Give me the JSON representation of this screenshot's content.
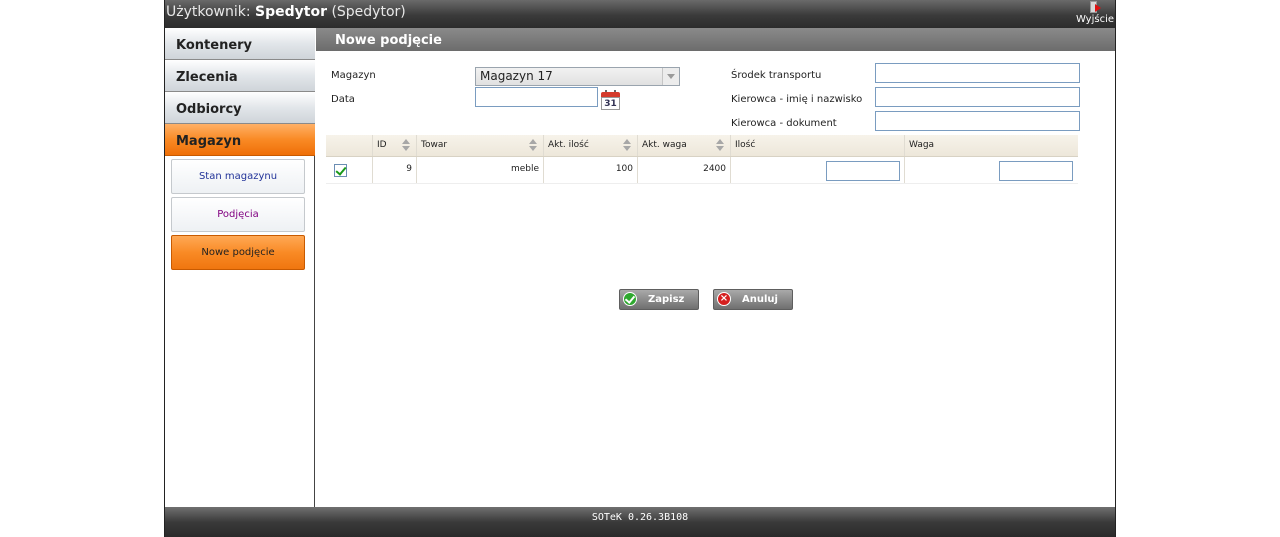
{
  "header": {
    "user_prefix": "Użytkownik: ",
    "user_name": "Spedytor",
    "user_role": " (Spedytor)",
    "logout_label": "Wyjście"
  },
  "sidebar": {
    "items": [
      {
        "label": "Kontenery"
      },
      {
        "label": "Zlecenia"
      },
      {
        "label": "Odbiorcy"
      },
      {
        "label": "Magazyn",
        "active": true
      }
    ],
    "subitems": [
      {
        "label": "Stan magazynu"
      },
      {
        "label": "Podjęcia"
      },
      {
        "label": "Nowe podjęcie",
        "active": true
      }
    ]
  },
  "main": {
    "title": "Nowe podjęcie",
    "form": {
      "magazyn_label": "Magazyn",
      "magazyn_value": "Magazyn 17",
      "data_label": "Data",
      "data_value": "",
      "calendar_day": "31",
      "srodek_label": "Środek transportu",
      "srodek_value": "",
      "kierowca_label": "Kierowca - imię i nazwisko",
      "kierowca_value": "",
      "dokument_label": "Kierowca - dokument",
      "dokument_value": ""
    },
    "table": {
      "columns": [
        "",
        "ID",
        "Towar",
        "Akt. ilość",
        "Akt. waga",
        "Ilość",
        "Waga"
      ],
      "rows": [
        {
          "checked": true,
          "id": "9",
          "towar": "meble",
          "akt_ilosc": "100",
          "akt_waga": "2400",
          "ilosc": "",
          "waga": ""
        }
      ]
    },
    "buttons": {
      "save": "Zapisz",
      "cancel": "Anuluj"
    }
  },
  "footer": {
    "version": "SOTeK 0.26.3B108"
  },
  "colors": {
    "accent_orange": "#f98a25",
    "header_dark": "#3a3a3a"
  }
}
